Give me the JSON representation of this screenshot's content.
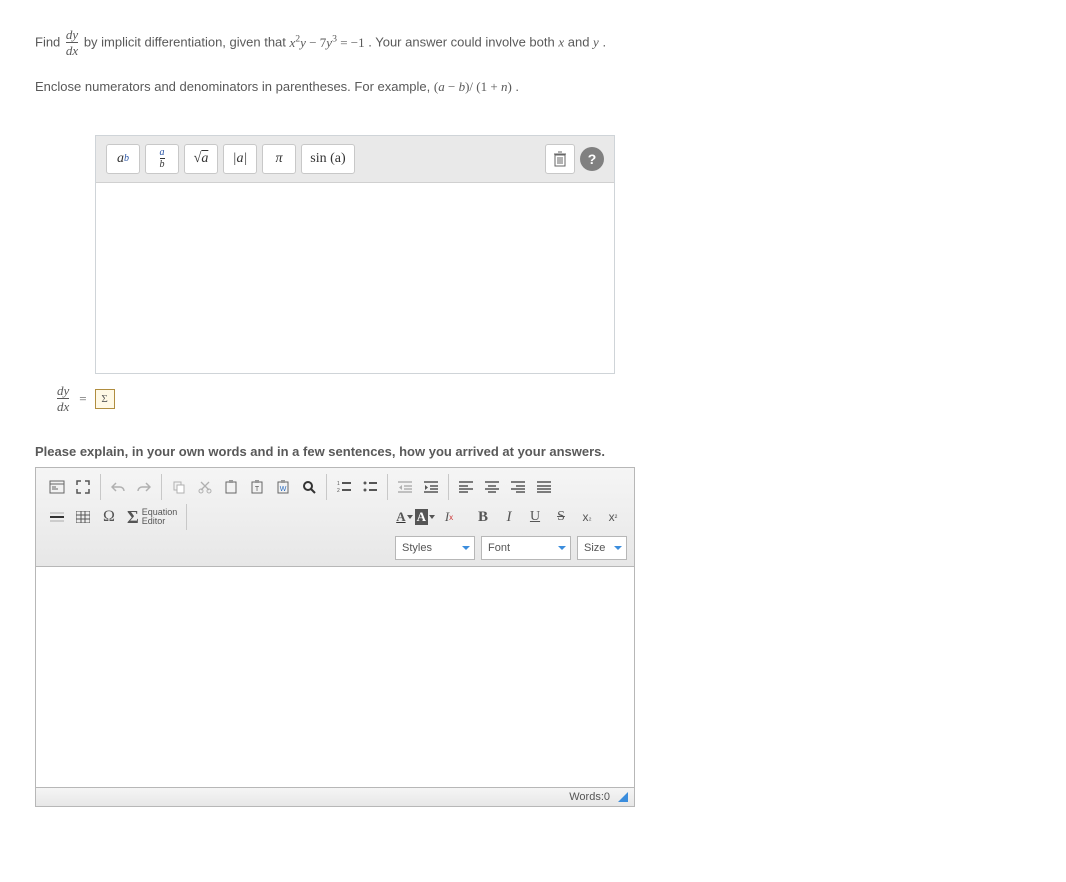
{
  "question": {
    "lead": "Find ",
    "frac_num": "dy",
    "frac_den": "dx",
    "mid": " by implicit differentiation, given that ",
    "equation_html": "x²y − 7y³ = −1",
    "tail": ". Your answer could involve both ",
    "var1": "x",
    "and": " and ",
    "var2": "y",
    "end": "."
  },
  "hint": {
    "text": "Enclose numerators and denominators in parentheses. For example, ",
    "example": "(a − b)/(1 + n)",
    "end": "."
  },
  "eq_toolbar": {
    "power_base": "a",
    "power_exp": "b",
    "frac_num": "a",
    "frac_den": "b",
    "sqrt": "a",
    "abs": "|a|",
    "pi": "π",
    "sin": "sin (a)"
  },
  "answer": {
    "lhs_num": "dy",
    "lhs_den": "dx",
    "equals": "=",
    "icon_char": "Σ"
  },
  "explain_prompt": "Please explain, in your own words and in a few sentences, how you arrived at your answers.",
  "ck": {
    "eq_editor_label": "Equation\nEditor",
    "styles": "Styles",
    "font": "Font",
    "size": "Size",
    "footer_label": "Words: ",
    "word_count": "0"
  }
}
